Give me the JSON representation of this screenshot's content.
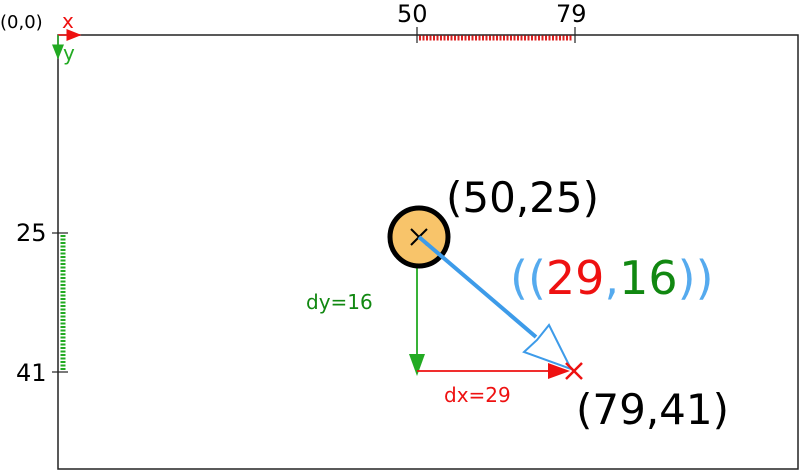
{
  "origin_label": "(0,0)",
  "axes": {
    "x_label": "x",
    "y_label": "y",
    "x_color": "#ee1111",
    "y_color": "#22aa22"
  },
  "top_ruler": {
    "start_label": "50",
    "end_label": "79"
  },
  "left_ruler": {
    "start_label": "25",
    "end_label": "41"
  },
  "point_start": {
    "label": "(50,25)",
    "marker": "x-mark",
    "circle_fill": "#f8c46a"
  },
  "point_end": {
    "label": "(79,41)",
    "marker": "x-mark"
  },
  "vector": {
    "open_paren": "((",
    "dx_value": "29",
    "separator": ",",
    "dy_value": "16",
    "close_paren": "))",
    "color": "#55aaee"
  },
  "dy_label": "dy=16",
  "dx_label": "dx=29",
  "colors": {
    "red": "#ee1111",
    "green": "#118811",
    "blue": "#3d9be9",
    "black": "#000000"
  }
}
